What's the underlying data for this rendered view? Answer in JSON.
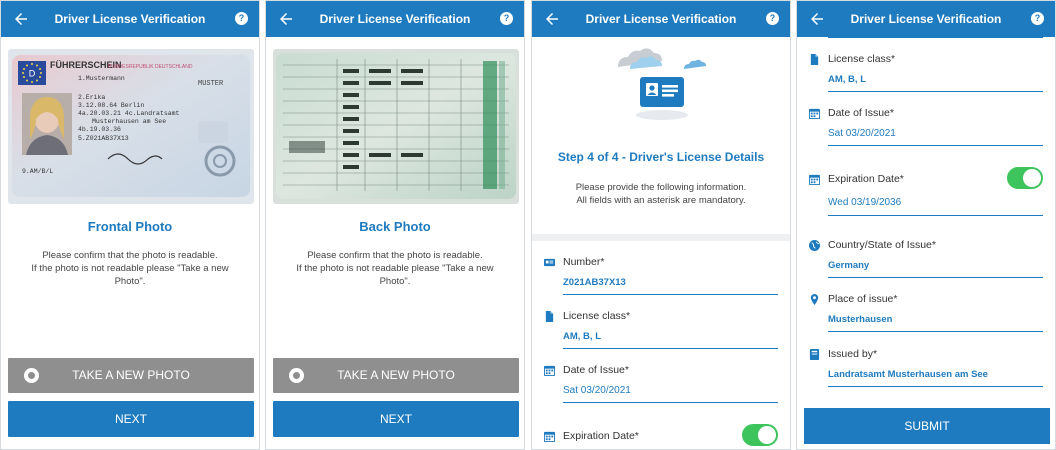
{
  "app": {
    "title": "Driver License Verification",
    "help_glyph": "?"
  },
  "front": {
    "photo_title": "Frontal Photo",
    "message_line1": "Please confirm that the photo is readable.",
    "message_line2": "If the photo is not readable please \"Take a new Photo\".",
    "card": {
      "header": "FÜHRERSCHEIN",
      "country_text": "BUNDESREPUBLIK DEUTSCHLAND",
      "country_code": "D",
      "name_corner": "MUSTER",
      "line1": "1.Mustermann",
      "line2": "2.Erika",
      "line3": "3.12.08.64  Berlin",
      "line4": "4a.20.03.21  4c.Landratsamt",
      "line5": "Musterhausen am See",
      "line6": "4b.19.03.36",
      "line7": "5.Z021AB37X13",
      "line8": "9.AM/B/L"
    }
  },
  "back": {
    "photo_title": "Back Photo",
    "message_line1": "Please confirm that the photo is readable.",
    "message_line2": "If the photo is not readable please \"Take a new Photo\"."
  },
  "buttons": {
    "take_photo": "TAKE A NEW PHOTO",
    "next": "NEXT",
    "submit": "SUBMIT"
  },
  "step": {
    "title": "Step 4 of 4 - Driver's License Details",
    "message_line1": "Please provide the following information.",
    "message_line2": "All fields with an asterisk are mandatory."
  },
  "fields": {
    "number": {
      "label": "Number*",
      "value": "Z021AB37X13",
      "icon": "id-card-icon"
    },
    "license_class": {
      "label": "License class*",
      "value": "AM, B, L",
      "icon": "document-icon"
    },
    "issue_date": {
      "label": "Date of Issue*",
      "value": "Sat 03/20/2021",
      "icon": "calendar-icon"
    },
    "expiration_date": {
      "label": "Expiration Date*",
      "value": "Wed 03/19/2036",
      "enabled": true,
      "icon": "calendar-icon"
    },
    "country": {
      "label": "Country/State of Issue*",
      "value": "Germany",
      "icon": "globe-icon"
    },
    "place": {
      "label": "Place of issue*",
      "value": "Musterhausen",
      "icon": "location-pin-icon"
    },
    "issued_by": {
      "label": "Issued by*",
      "value": "Landratsamt Musterhausen am See",
      "icon": "book-icon"
    }
  },
  "colors": {
    "primary": "#1f7bbf",
    "gray_button": "#8f8f8f",
    "toggle_on": "#3ec45c"
  }
}
